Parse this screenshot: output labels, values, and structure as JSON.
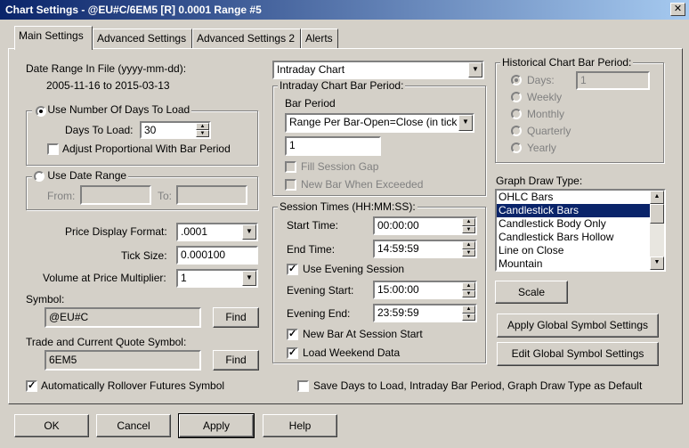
{
  "window": {
    "title": "Chart Settings - @EU#C/6EM5 [R]  0.0001 Range  #5",
    "close": "✕"
  },
  "tabs": [
    "Main Settings",
    "Advanced Settings",
    "Advanced Settings 2",
    "Alerts"
  ],
  "date_range": {
    "label": "Date Range In File (yyyy-mm-dd):",
    "value": "2005-11-16 to 2015-03-13"
  },
  "days_group": {
    "radio_label": "Use Number Of Days To Load",
    "days_label": "Days To Load:",
    "days_value": "30",
    "adjust_label": "Adjust Proportional With Bar Period"
  },
  "date_group": {
    "radio_label": "Use Date Range",
    "from_label": "From:",
    "to_label": "To:"
  },
  "price_format": {
    "label": "Price Display Format:",
    "value": ".0001"
  },
  "tick_size": {
    "label": "Tick Size:",
    "value": "0.000100"
  },
  "volume_mult": {
    "label": "Volume at Price Multiplier:",
    "value": "1"
  },
  "symbol": {
    "label": "Symbol:",
    "value": "@EU#C",
    "find": "Find"
  },
  "trade_symbol": {
    "label": "Trade and Current Quote Symbol:",
    "value": "6EM5",
    "find": "Find"
  },
  "rollover": {
    "label": "Automatically Rollover Futures Symbol"
  },
  "chart_type": {
    "value": "Intraday Chart"
  },
  "intraday_bar": {
    "title": "Intraday Chart Bar Period:",
    "bar_period_label": "Bar Period",
    "bar_period_value": "Range Per Bar-Open=Close (in tick",
    "bar_value": "1",
    "fill_gap": "Fill Session Gap",
    "new_bar": "New Bar When Exceeded"
  },
  "session": {
    "title": "Session Times (HH:MM:SS):",
    "start_label": "Start Time:",
    "start_value": "00:00:00",
    "end_label": "End Time:",
    "end_value": "14:59:59",
    "use_evening": "Use Evening Session",
    "eve_start_label": "Evening Start:",
    "eve_start_value": "15:00:00",
    "eve_end_label": "Evening End:",
    "eve_end_value": "23:59:59",
    "new_bar_session": "New Bar At Session Start",
    "load_weekend": "Load Weekend Data"
  },
  "historical": {
    "title": "Historical Chart Bar Period:",
    "days": "Days:",
    "days_value": "1",
    "weekly": "Weekly",
    "monthly": "Monthly",
    "quarterly": "Quarterly",
    "yearly": "Yearly"
  },
  "graph_draw": {
    "label": "Graph Draw Type:",
    "items": [
      "OHLC Bars",
      "Candlestick Bars",
      "Candlestick Body Only",
      "Candlestick Bars Hollow",
      "Line on Close",
      "Mountain"
    ],
    "selected_index": 1
  },
  "scale_button": "Scale",
  "apply_global": "Apply Global Symbol Settings",
  "edit_global": "Edit Global Symbol Settings",
  "save_default": "Save Days to Load, Intraday Bar Period, Graph Draw Type as Default",
  "footer": {
    "ok": "OK",
    "cancel": "Cancel",
    "apply": "Apply",
    "help": "Help"
  },
  "icons": {
    "dropdown": "chevron-down-icon",
    "spin_up": "spin-up-icon",
    "spin_down": "spin-down-icon",
    "check": "checkmark-icon"
  }
}
